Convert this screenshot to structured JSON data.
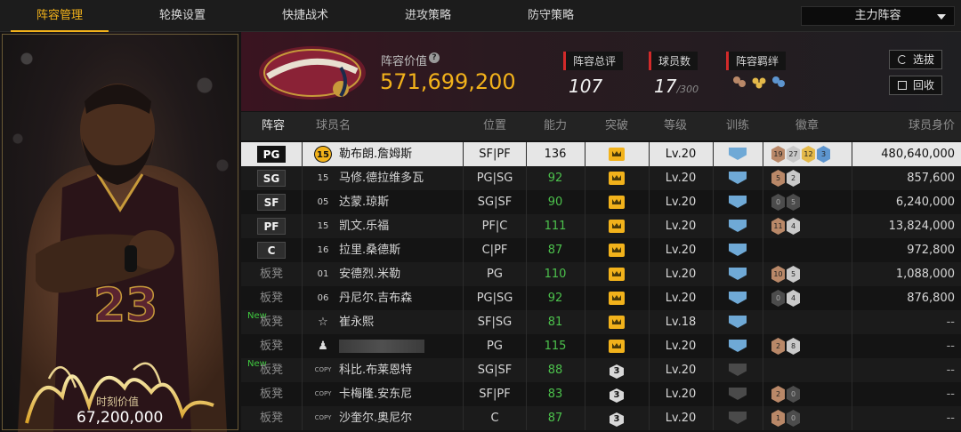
{
  "tabs": [
    "阵容管理",
    "轮换设置",
    "快捷战术",
    "进攻策略",
    "防守策略"
  ],
  "lineup_select": "主力阵容",
  "card": {
    "time_value_label": "时刻价值",
    "time_value": "67,200,000"
  },
  "header": {
    "lineup_value_label": "阵容价值",
    "lineup_value": "571,699,200",
    "overall_label": "阵容总评",
    "overall_value": "107",
    "player_count_label": "球员数",
    "player_count": "17",
    "player_count_max": "/300",
    "bond_label": "阵容羁绊",
    "select_button": "选拔",
    "recycle_button": "回收"
  },
  "columns": [
    "阵容",
    "球员名",
    "位置",
    "能力",
    "突破",
    "等级",
    "训练",
    "徽章",
    "球员身价"
  ],
  "rows": [
    {
      "slot": "PG",
      "bench": false,
      "new": "",
      "jersey": "15",
      "jersey_type": "badge15",
      "name": "勒布朗.詹姆斯",
      "pos": "SF|PF",
      "power": "136",
      "breakthrough": "crown",
      "level": "Lv.20",
      "training": "on",
      "badges": [
        [
          "bronze",
          "19"
        ],
        [
          "silver",
          "27"
        ],
        [
          "gold",
          "12"
        ],
        [
          "blue",
          "3"
        ]
      ],
      "value": "480,640,000"
    },
    {
      "slot": "SG",
      "bench": false,
      "new": "",
      "jersey": "15",
      "jersey_type": "num",
      "name": "马修.德拉维多瓦",
      "pos": "PG|SG",
      "power": "92",
      "breakthrough": "crown",
      "level": "Lv.20",
      "training": "on",
      "badges": [
        [
          "bronze",
          "5"
        ],
        [
          "silver",
          "2"
        ]
      ],
      "value": "857,600"
    },
    {
      "slot": "SF",
      "bench": false,
      "new": "",
      "jersey": "05",
      "jersey_type": "num",
      "name": "达蒙.琼斯",
      "pos": "SG|SF",
      "power": "90",
      "breakthrough": "crown",
      "level": "Lv.20",
      "training": "on",
      "badges": [
        [
          "dark",
          "0"
        ],
        [
          "dark",
          "5"
        ]
      ],
      "value": "6,240,000"
    },
    {
      "slot": "PF",
      "bench": false,
      "new": "",
      "jersey": "15",
      "jersey_type": "num",
      "name": "凯文.乐福",
      "pos": "PF|C",
      "power": "111",
      "breakthrough": "crown",
      "level": "Lv.20",
      "training": "on",
      "badges": [
        [
          "bronze",
          "11"
        ],
        [
          "silver",
          "4"
        ]
      ],
      "value": "13,824,000"
    },
    {
      "slot": "C",
      "bench": false,
      "new": "",
      "jersey": "16",
      "jersey_type": "num",
      "name": "拉里.桑德斯",
      "pos": "C|PF",
      "power": "87",
      "breakthrough": "crown",
      "level": "Lv.20",
      "training": "on",
      "badges": [],
      "value": "972,800"
    },
    {
      "slot": "板凳",
      "bench": true,
      "new": "",
      "jersey": "01",
      "jersey_type": "num",
      "name": "安德烈.米勒",
      "pos": "PG",
      "power": "110",
      "breakthrough": "crown",
      "level": "Lv.20",
      "training": "on",
      "badges": [
        [
          "bronze",
          "10"
        ],
        [
          "silver",
          "5"
        ]
      ],
      "value": "1,088,000"
    },
    {
      "slot": "板凳",
      "bench": true,
      "new": "",
      "jersey": "06",
      "jersey_type": "num",
      "name": "丹尼尔.吉布森",
      "pos": "PG|SG",
      "power": "92",
      "breakthrough": "crown",
      "level": "Lv.20",
      "training": "on",
      "badges": [
        [
          "dark",
          "0"
        ],
        [
          "silver",
          "4"
        ]
      ],
      "value": "876,800"
    },
    {
      "slot": "板凳",
      "bench": true,
      "new": "New",
      "jersey": "☆",
      "jersey_type": "star",
      "name": "崔永熙",
      "pos": "SF|SG",
      "power": "81",
      "breakthrough": "crown",
      "level": "Lv.18",
      "training": "on",
      "badges": [],
      "value": "--"
    },
    {
      "slot": "板凳",
      "bench": true,
      "new": "",
      "jersey": "♟",
      "jersey_type": "star",
      "name": "",
      "pos": "PG",
      "power": "115",
      "breakthrough": "crown",
      "level": "Lv.20",
      "training": "on",
      "badges": [
        [
          "bronze",
          "2"
        ],
        [
          "silver",
          "8"
        ]
      ],
      "value": "--"
    },
    {
      "slot": "板凳",
      "bench": true,
      "new": "New",
      "jersey": "COPY",
      "jersey_type": "copy",
      "name": "科比.布莱恩特",
      "pos": "SG|SF",
      "power": "88",
      "breakthrough": "3",
      "level": "Lv.20",
      "training": "off",
      "badges": [],
      "value": "--"
    },
    {
      "slot": "板凳",
      "bench": true,
      "new": "",
      "jersey": "COPY",
      "jersey_type": "copy",
      "name": "卡梅隆.安东尼",
      "pos": "SF|PF",
      "power": "83",
      "breakthrough": "3",
      "level": "Lv.20",
      "training": "off",
      "badges": [
        [
          "bronze",
          "2"
        ],
        [
          "dark",
          "0"
        ]
      ],
      "value": "--"
    },
    {
      "slot": "板凳",
      "bench": true,
      "new": "",
      "jersey": "COPY",
      "jersey_type": "copy",
      "name": "沙奎尔.奥尼尔",
      "pos": "C",
      "power": "87",
      "breakthrough": "3",
      "level": "Lv.20",
      "training": "off",
      "badges": [
        [
          "bronze",
          "1"
        ],
        [
          "dark",
          "0"
        ]
      ],
      "value": "--"
    }
  ]
}
